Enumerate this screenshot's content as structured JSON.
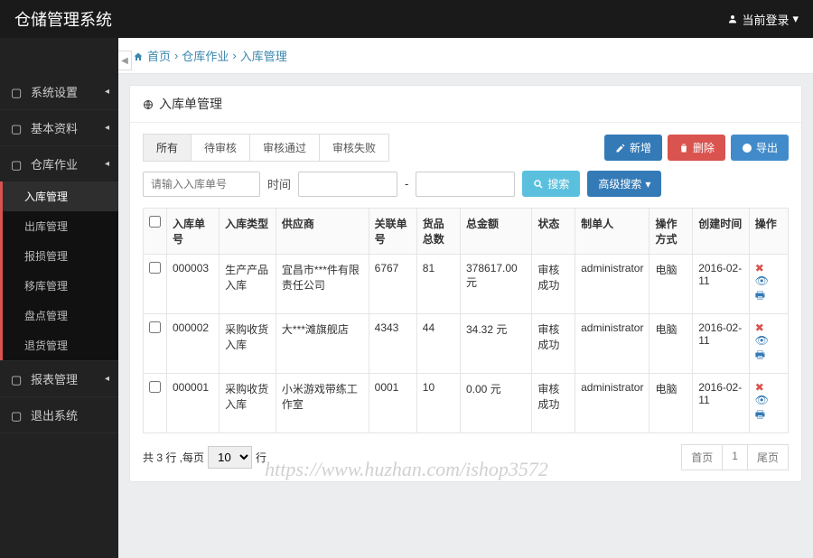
{
  "brand": "仓储管理系统",
  "login_label": "当前登录",
  "breadcrumb": {
    "home": "首页",
    "sep": "›",
    "l1": "仓库作业",
    "l2": "入库管理"
  },
  "sidebar": {
    "groups": [
      {
        "label": "系统设置"
      },
      {
        "label": "基本资料"
      },
      {
        "label": "仓库作业",
        "items": [
          "入库管理",
          "出库管理",
          "报损管理",
          "移库管理",
          "盘点管理",
          "退货管理"
        ],
        "active": 0
      },
      {
        "label": "报表管理"
      },
      {
        "label": "退出系统"
      }
    ]
  },
  "panel": {
    "title": "入库单管理"
  },
  "tabs": [
    "所有",
    "待审核",
    "审核通过",
    "审核失败"
  ],
  "buttons": {
    "add": "新增",
    "delete": "删除",
    "export": "导出",
    "search": "搜索",
    "adv_search": "高级搜索"
  },
  "search": {
    "placeholder": "请输入入库单号",
    "time_label": "时间",
    "range_sep": "-"
  },
  "table": {
    "headers": [
      "入库单号",
      "入库类型",
      "供应商",
      "关联单号",
      "货品总数",
      "总金额",
      "状态",
      "制单人",
      "操作方式",
      "创建时间",
      "操作"
    ],
    "rows": [
      {
        "id": "000003",
        "type": "生产产品入库",
        "supplier": "宜昌市***件有限责任公司",
        "ref": "6767",
        "qty": "81",
        "amount": "378617.00 元",
        "status": "审核成功",
        "maker": "administrator",
        "mode": "电脑",
        "time": "2016-02-11"
      },
      {
        "id": "000002",
        "type": "采购收货入库",
        "supplier": "大***滩旗舰店",
        "ref": "4343",
        "qty": "44",
        "amount": "34.32 元",
        "status": "审核成功",
        "maker": "administrator",
        "mode": "电脑",
        "time": "2016-02-11"
      },
      {
        "id": "000001",
        "type": "采购收货入库",
        "supplier": "小米游戏带练工作室",
        "ref": "0001",
        "qty": "10",
        "amount": "0.00 元",
        "status": "审核成功",
        "maker": "administrator",
        "mode": "电脑",
        "time": "2016-02-11"
      }
    ]
  },
  "footer": {
    "total_prefix": "共 3 行 ,每页",
    "total_suffix": "行",
    "page_size": "10",
    "first": "首页",
    "page": "1",
    "last": "尾页"
  },
  "watermark": "https://www.huzhan.com/ishop3572"
}
